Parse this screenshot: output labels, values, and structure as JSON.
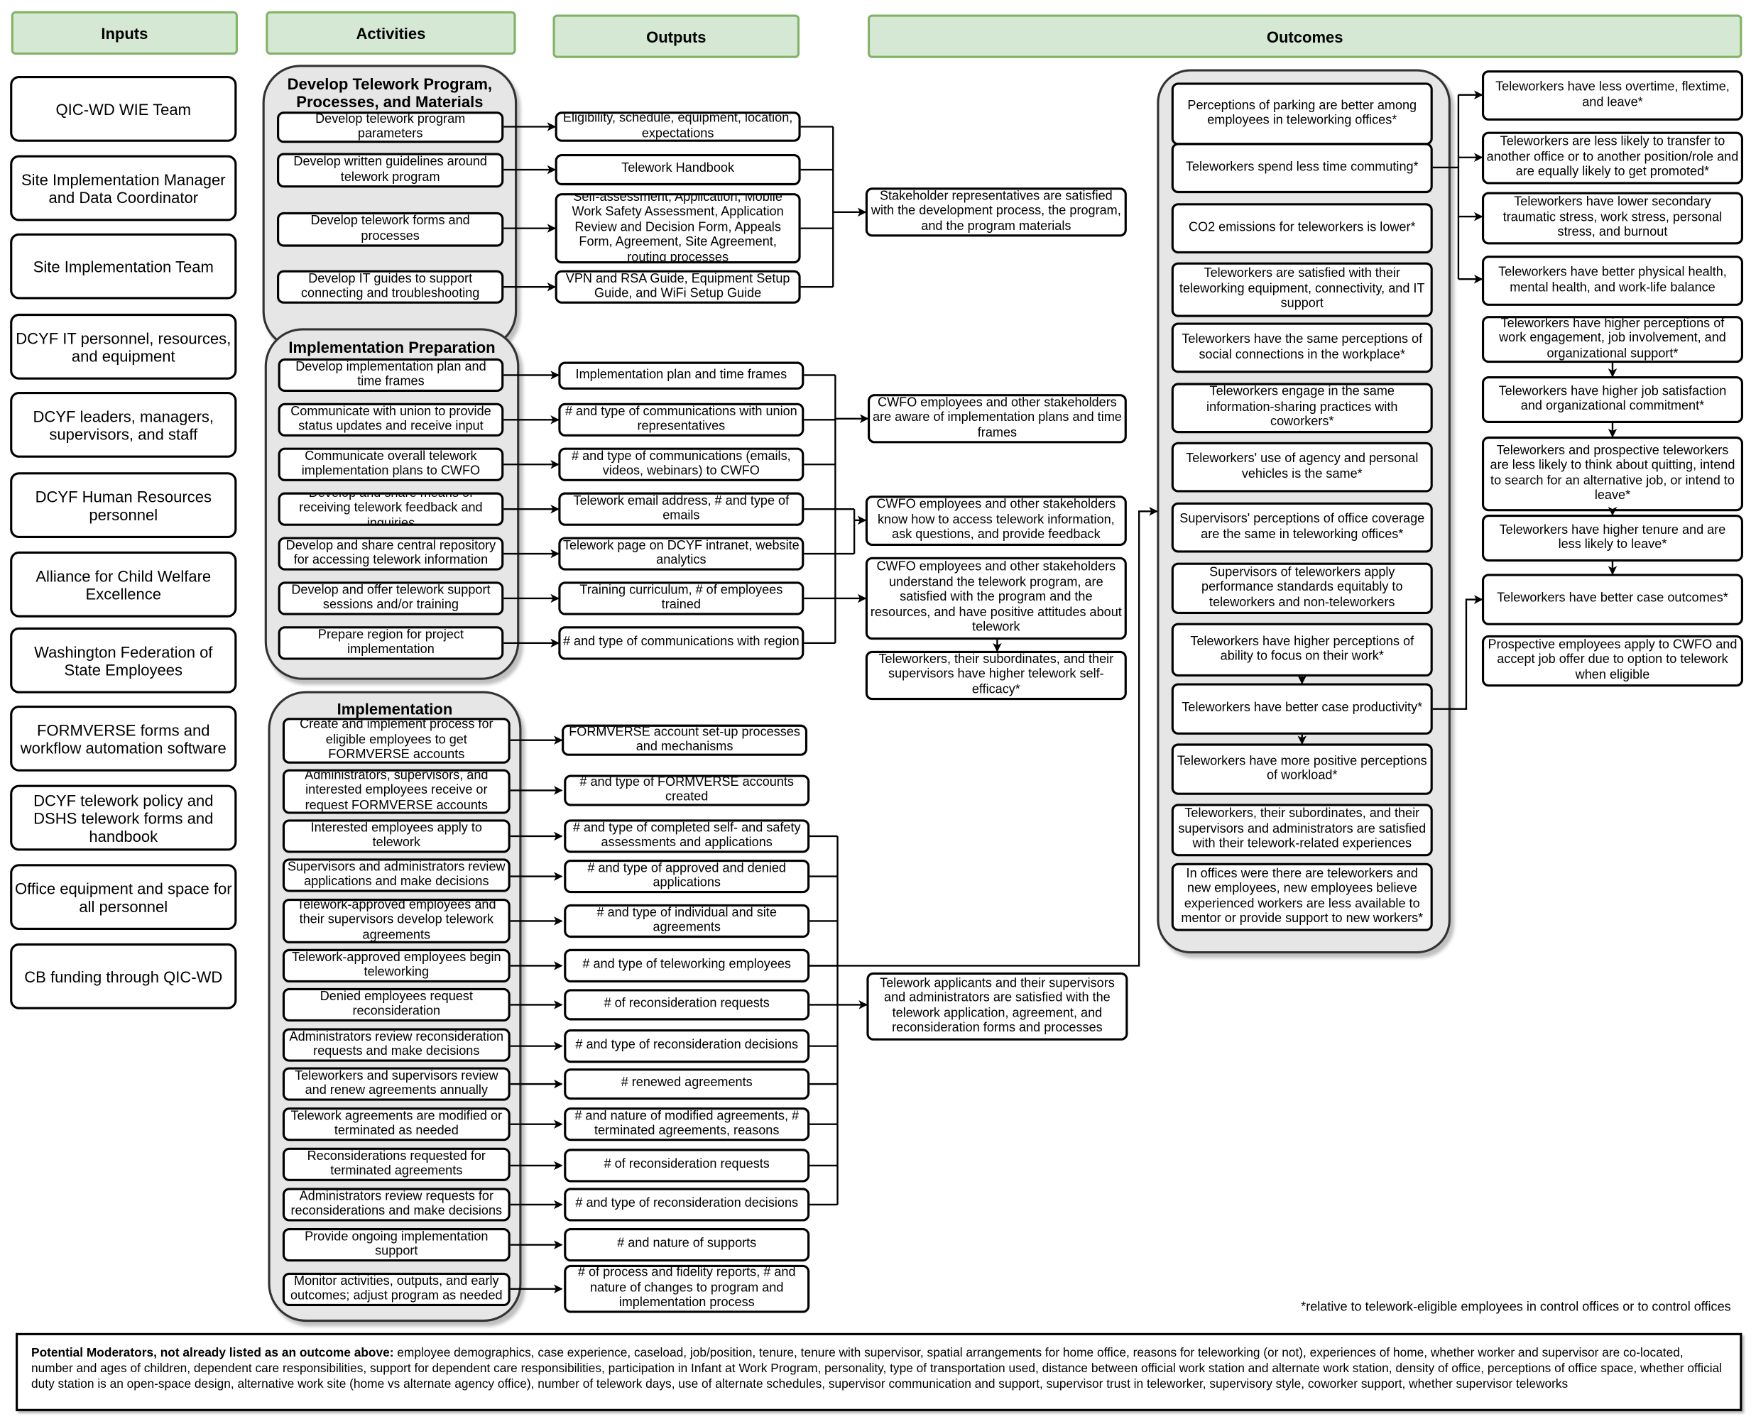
{
  "headers": {
    "inputs": "Inputs",
    "activities": "Activities",
    "outputs": "Outputs",
    "outcomes": "Outcomes"
  },
  "colors": {
    "header_fill": "#d5e8d4",
    "header_border": "#82b366",
    "group_fill": "#e6e6e6"
  },
  "inputs": [
    "QIC-WD WIE Team",
    "Site Implementation Manager and Data Coordinator",
    "Site Implementation Team",
    "DCYF IT personnel, resources, and equipment",
    "DCYF leaders, managers, supervisors, and staff",
    "DCYF Human Resources personnel",
    "Alliance for Child Welfare Excellence",
    "Washington Federation of State Employees",
    "FORMVERSE forms and workflow automation software",
    "DCYF telework policy and DSHS telework forms and handbook",
    "Office equipment and space for all personnel",
    "CB funding through QIC-WD"
  ],
  "groups": [
    {
      "title": "Develop Telework Program, Processes, and Materials",
      "activities": [
        "Develop telework program parameters",
        "Develop written guidelines around telework program",
        "Develop telework forms and processes",
        "Develop IT guides to support connecting and troubleshooting"
      ],
      "outputs": [
        "Eligibility, schedule, equipment, location, expectations",
        "Telework Handbook",
        "Self-assessment, Application, Mobile Work Safety Assessment, Application Review and Decision Form, Appeals Form, Agreement, Site Agreement, routing processes",
        "VPN and RSA Guide,  Equipment Setup Guide, and WiFi Setup Guide"
      ]
    },
    {
      "title": "Implementation Preparation",
      "activities": [
        "Develop implementation plan and time frames",
        "Communicate with union to provide status updates and receive input",
        "Communicate overall telework implementation plans to CWFO",
        "Develop and share means of receiving telework feedback and inquiries",
        "Develop and share central repository for accessing telework information",
        "Develop and offer telework support sessions and/or training",
        "Prepare region for project implementation"
      ],
      "outputs": [
        "Implementation plan and time frames",
        "# and type of communications with union representatives",
        "# and type of communications (emails, videos, webinars) to CWFO",
        "Telework email address, # and type of emails",
        "Telework page on DCYF intranet, website analytics",
        "Training curriculum, # of employees trained",
        "# and type of communications with region"
      ]
    },
    {
      "title": "Implementation",
      "activities": [
        "Create and implement process for eligible employees to get FORMVERSE accounts",
        "Administrators, supervisors, and interested employees receive or request FORMVERSE accounts",
        "Interested employees apply to telework",
        "Supervisors and administrators review applications and make decisions",
        "Telework-approved employees and their supervisors develop telework agreements",
        "Telework-approved employees begin teleworking",
        "Denied employees request reconsideration",
        "Administrators review reconsideration requests and make decisions",
        "Teleworkers and supervisors review and renew agreements annually",
        "Telework agreements are modified or terminated as needed",
        "Reconsiderations requested for terminated agreements",
        "Administrators review requests for reconsiderations and make decisions",
        "Provide ongoing implementation support",
        "Monitor activities, outputs, and early outcomes; adjust program as needed"
      ],
      "outputs": [
        "FORMVERSE account set-up processes and mechanisms",
        "# and type of FORMVERSE accounts created",
        "# and type of completed self- and safety assessments and applications",
        "# and type of approved and denied applications",
        "# and type of individual and site agreements",
        "# and type of teleworking employees",
        "# of reconsideration requests",
        "# and type of reconsideration decisions",
        "# renewed agreements",
        "# and nature of modified agreements, # terminated agreements, reasons",
        "# of reconsideration requests",
        "# and type of reconsideration decisions",
        "# and nature of supports",
        "# of process and fidelity reports, # and nature of changes to program and implementation process"
      ]
    }
  ],
  "short_outcomes": [
    "Stakeholder representatives are satisfied with the development process, the program, and the program materials",
    "CWFO employees and other stakeholders are aware of implementation plans and time frames",
    "CWFO employees and other stakeholders know how to access telework information, ask questions, and provide feedback",
    "CWFO employees and other stakeholders understand the telework program, are satisfied with the program and the resources, and have positive attitudes about telework",
    "Teleworkers, their subordinates, and their supervisors have higher telework self-efficacy*",
    "Telework applicants and their supervisors and administrators are satisfied with the telework application, agreement, and reconsideration forms and processes"
  ],
  "outcomes": {
    "grouped": [
      "Perceptions of parking are better among employees in teleworking offices*",
      "Teleworkers spend less time commuting*",
      "CO2 emissions for teleworkers is lower*",
      "Teleworkers are satisfied with their teleworking equipment, connectivity, and IT support",
      "Teleworkers have the same perceptions of social connections in the workplace*",
      "Teleworkers engage in the same information-sharing practices with coworkers*",
      "Teleworkers' use of agency and personal vehicles is the same*",
      "Supervisors' perceptions of office coverage are the same in teleworking offices*",
      "Supervisors of teleworkers apply performance standards equitably to teleworkers and non-teleworkers",
      "Teleworkers have higher perceptions of ability to focus on their work*",
      "Teleworkers have better case productivity*",
      "Teleworkers have more positive perceptions of workload*",
      "Teleworkers, their subordinates, and their supervisors and administrators are satisfied with their telework-related experiences",
      "In offices were there are teleworkers and new employees, new employees believe experienced workers are less available to mentor or provide support to new workers*"
    ],
    "long_term": [
      "Teleworkers have less overtime, flextime, and leave*",
      "Teleworkers are less likely to transfer to another office or to another position/role and are equally likely to get promoted*",
      "Teleworkers have lower secondary traumatic stress, work stress, personal stress, and burnout",
      "Teleworkers have better physical health, mental health, and work-life balance",
      "Teleworkers have higher perceptions of work engagement, job involvement, and organizational support*",
      "Teleworkers have higher job satisfaction and organizational commitment*",
      "Teleworkers and prospective teleworkers are less likely to think about quitting, intend to search for an alternative job, or intend to leave*",
      "Teleworkers have higher tenure and are less likely to leave*",
      "Teleworkers have better case outcomes*",
      "Prospective employees apply to CWFO and accept job offer due to option to telework when eligible"
    ]
  },
  "footnote": "*relative to telework-eligible employees in control offices or to control offices",
  "moderators": {
    "label": "Potential Moderators, not already listed as an outcome above:",
    "text": " employee demographics, case experience, caseload, job/position, tenure, tenure with supervisor, spatial arrangements for home office, reasons for teleworking (or not), experiences of home, whether worker and supervisor are co-located, number and ages of children, dependent care responsibilities, support for dependent care responsibilities, participation in Infant at Work Program, personality, type of transportation used, distance between official work station and alternate work station, density of office, perceptions of office space, whether official duty station is an open-space design, alternative work site (home vs alternate agency office), number of telework days, use of alternate schedules, supervisor communication and support, supervisor trust in teleworker, supervisory style, coworker support, whether supervisor teleworks"
  }
}
